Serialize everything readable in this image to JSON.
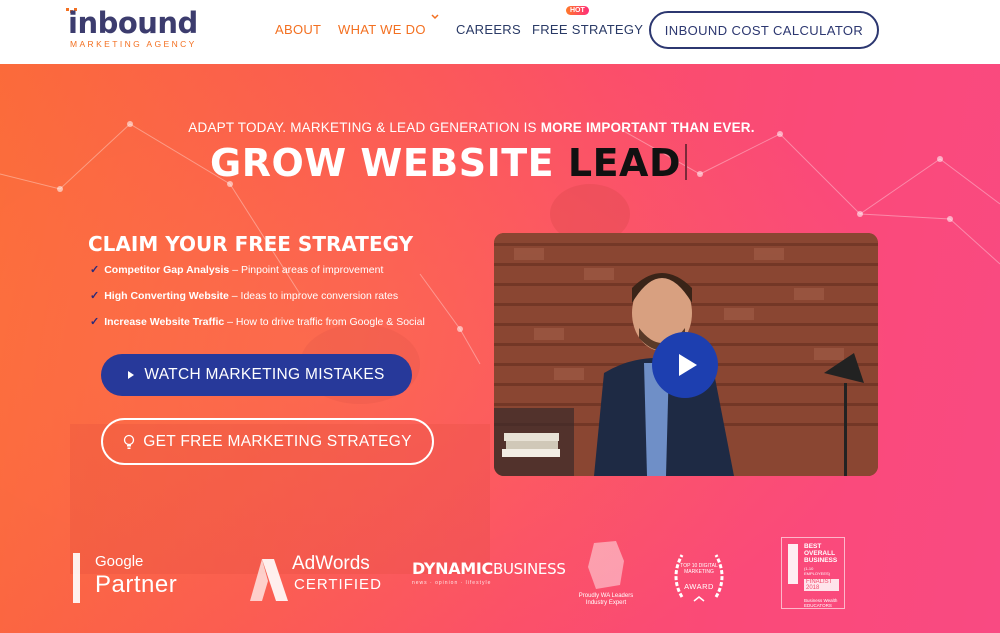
{
  "header": {
    "logo_main": "inbound",
    "logo_sub": "MARKETING AGENCY",
    "nav": {
      "about": "ABOUT",
      "what_we_do": "WHAT WE DO",
      "careers": "CAREERS",
      "free_strategy": "FREE STRATEGY",
      "hot_badge": "HOT"
    },
    "cta": "INBOUND COST CALCULATOR"
  },
  "hero": {
    "tagline_prefix": "ADAPT TODAY. MARKETING & LEAD GENERATION IS ",
    "tagline_bold": "MORE IMPORTANT THAN EVER.",
    "headline_main": "GROW WEBSITE ",
    "headline_typed": "LEAD",
    "claim_title": "CLAIM YOUR FREE STRATEGY",
    "bullets": [
      {
        "title": "Competitor Gap Analysis",
        "text": " – Pinpoint areas of improvement"
      },
      {
        "title": "High Converting Website",
        "text": " – Ideas to improve conversion rates"
      },
      {
        "title": "Increase Website Traffic",
        "text": " – How to drive traffic from Google & Social"
      }
    ],
    "watch_button": "WATCH MARKETING MISTAKES",
    "free_button": "GET FREE MARKETING STRATEGY"
  },
  "badges": {
    "google_1": "Google",
    "google_2": "Partner",
    "adwords_1": "AdWords",
    "adwords_2": "CERTIFIED",
    "dynamic_1": "DYNAMIC",
    "dynamic_2": "BUSINESS",
    "dynamic_sub": "news · opinion · lifestyle",
    "wa": "Proudly WA Leaders Industry Expert",
    "award_top": "TOP 10 DIGITAL MARKETING",
    "award_bottom": "AWARD",
    "best_1": "BEST OVERALL BUSINESS",
    "best_2": "(1-10 EMPLOYEES)",
    "best_3": "FINALIST 2018",
    "best_4": "Business Wealth EDUCATORS"
  },
  "colors": {
    "brand_orange": "#f37021",
    "brand_navy": "#2c3770",
    "button_blue": "#27399a"
  }
}
